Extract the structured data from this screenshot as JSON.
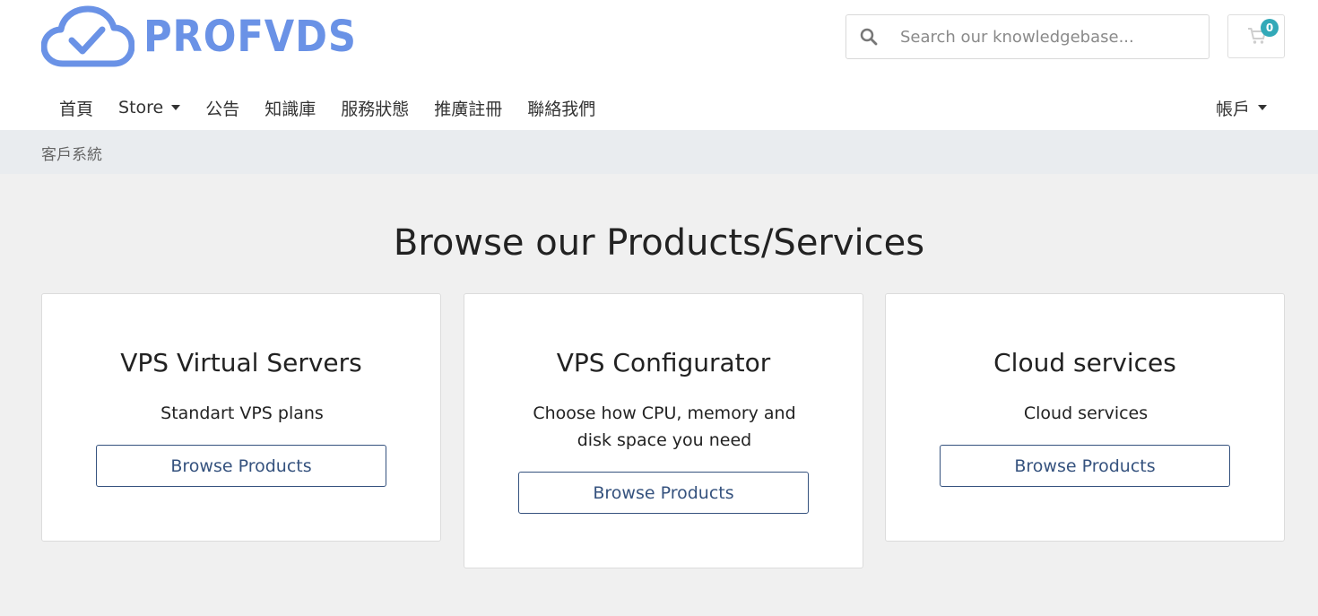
{
  "brand": {
    "name": "PROFVDS",
    "color": "#6a92e6"
  },
  "search": {
    "placeholder": "Search our knowledgebase...",
    "value": ""
  },
  "cart": {
    "count": "0",
    "badge_color": "#32a9b8"
  },
  "nav": {
    "items": [
      {
        "label": "首頁",
        "dropdown": false
      },
      {
        "label": "Store",
        "dropdown": true
      },
      {
        "label": "公告",
        "dropdown": false
      },
      {
        "label": "知識庫",
        "dropdown": false
      },
      {
        "label": "服務狀態",
        "dropdown": false
      },
      {
        "label": "推廣註冊",
        "dropdown": false
      },
      {
        "label": "聯絡我們",
        "dropdown": false
      }
    ],
    "account_label": "帳戶"
  },
  "breadcrumb": {
    "current": "客戶系統"
  },
  "main": {
    "title": "Browse our Products/Services",
    "cards": [
      {
        "title": "VPS Virtual Servers",
        "description": "Standart VPS plans",
        "button_label": "Browse Products"
      },
      {
        "title": "VPS Configurator",
        "description": "Choose how CPU, memory and disk space you need",
        "button_label": "Browse Products"
      },
      {
        "title": "Cloud services",
        "description": "Cloud services",
        "button_label": "Browse Products"
      }
    ]
  },
  "colors": {
    "button_border": "#35527e",
    "breadcrumb_bg": "#e9ecef",
    "page_bg": "#f0f0f0"
  }
}
